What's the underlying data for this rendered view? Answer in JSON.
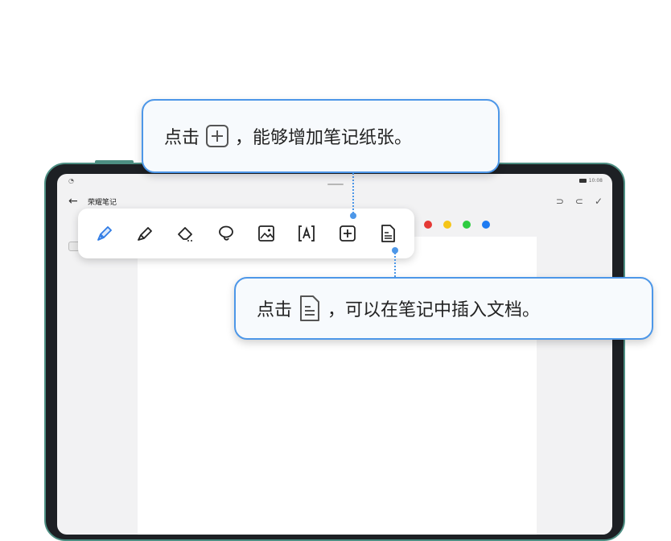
{
  "callout_add": {
    "prefix": "点击",
    "suffix": "，能够增加笔记纸张。",
    "icon": "add-page-icon"
  },
  "callout_doc": {
    "prefix": "点击",
    "suffix": "，可以在笔记中插入文档。",
    "icon": "document-icon"
  },
  "statusbar": {
    "time": "10:08"
  },
  "app": {
    "back_icon": "back-arrow-icon",
    "title": "荣耀笔记"
  },
  "actions": {
    "undo": "⊃",
    "redo": "⊂",
    "done": "✓"
  },
  "toolbar": {
    "tools": [
      "pen-icon",
      "highlighter-icon",
      "eraser-icon",
      "lasso-icon",
      "image-icon",
      "text-icon",
      "add-page-icon",
      "document-icon"
    ]
  },
  "palette": {
    "colors": [
      "#e53935",
      "#f5c518",
      "#2ecc40",
      "#1e7bf2"
    ]
  },
  "colors": {
    "accent": "#4d97e8",
    "frame": "#4d8f83"
  }
}
